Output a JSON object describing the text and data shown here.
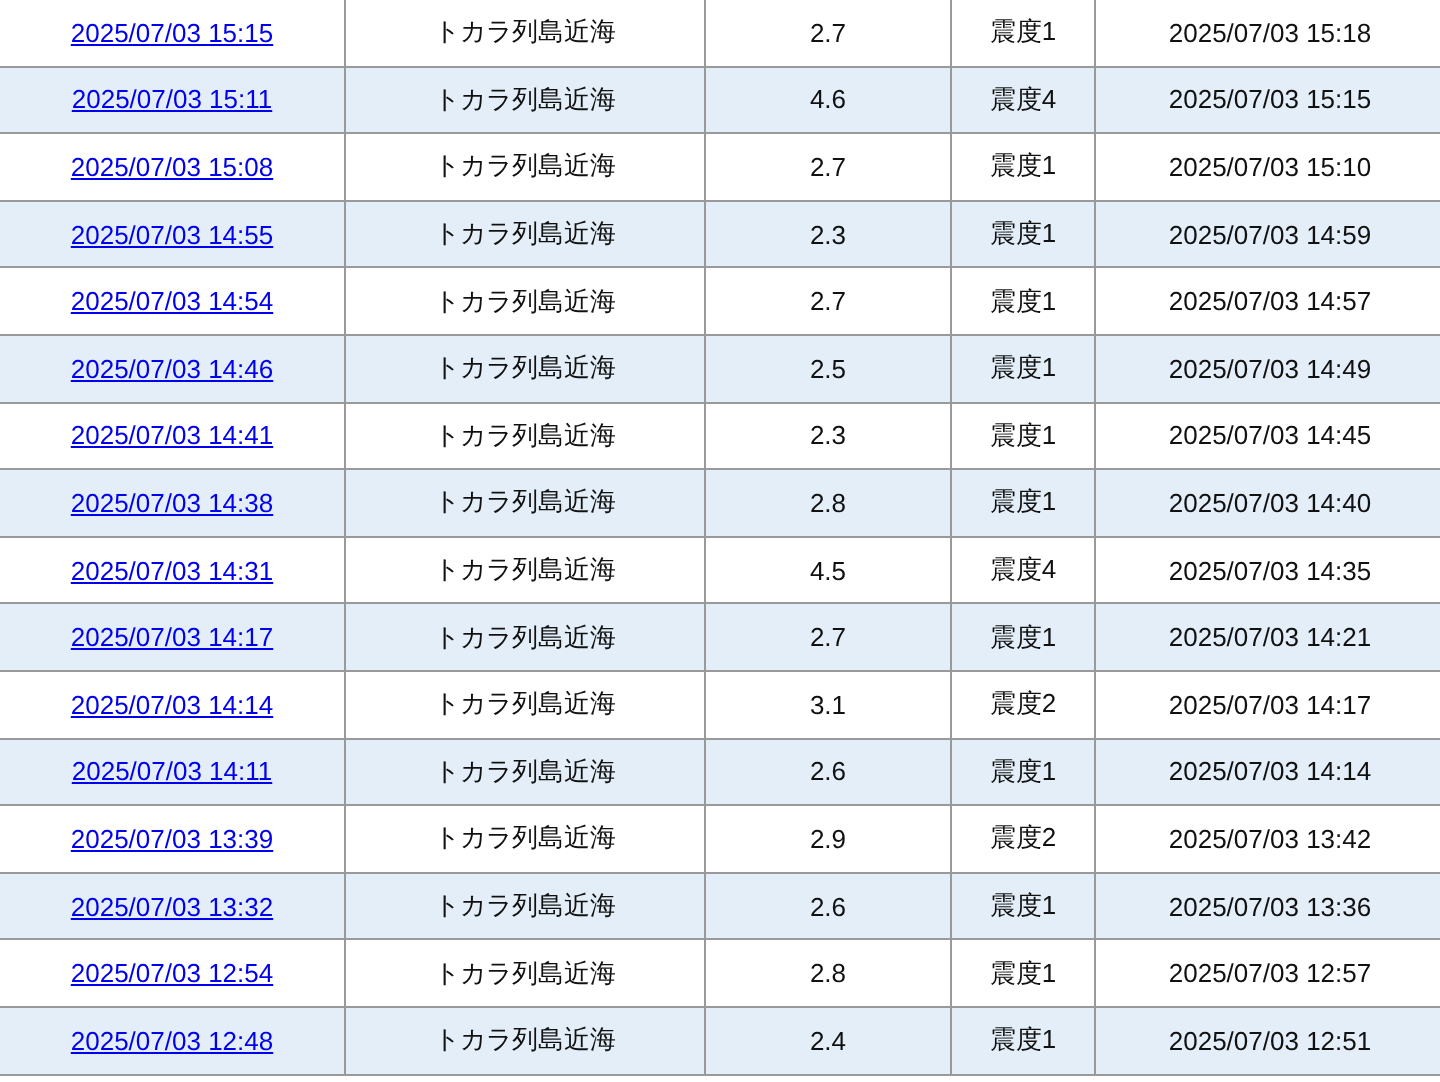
{
  "table": {
    "rows": [
      {
        "time": "2025/07/03 15:15",
        "epicenter": "トカラ列島近海",
        "magnitude": "2.7",
        "intensity": "震度1",
        "announced": "2025/07/03 15:18"
      },
      {
        "time": "2025/07/03 15:11",
        "epicenter": "トカラ列島近海",
        "magnitude": "4.6",
        "intensity": "震度4",
        "announced": "2025/07/03 15:15"
      },
      {
        "time": "2025/07/03 15:08",
        "epicenter": "トカラ列島近海",
        "magnitude": "2.7",
        "intensity": "震度1",
        "announced": "2025/07/03 15:10"
      },
      {
        "time": "2025/07/03 14:55",
        "epicenter": "トカラ列島近海",
        "magnitude": "2.3",
        "intensity": "震度1",
        "announced": "2025/07/03 14:59"
      },
      {
        "time": "2025/07/03 14:54",
        "epicenter": "トカラ列島近海",
        "magnitude": "2.7",
        "intensity": "震度1",
        "announced": "2025/07/03 14:57"
      },
      {
        "time": "2025/07/03 14:46",
        "epicenter": "トカラ列島近海",
        "magnitude": "2.5",
        "intensity": "震度1",
        "announced": "2025/07/03 14:49"
      },
      {
        "time": "2025/07/03 14:41",
        "epicenter": "トカラ列島近海",
        "magnitude": "2.3",
        "intensity": "震度1",
        "announced": "2025/07/03 14:45"
      },
      {
        "time": "2025/07/03 14:38",
        "epicenter": "トカラ列島近海",
        "magnitude": "2.8",
        "intensity": "震度1",
        "announced": "2025/07/03 14:40"
      },
      {
        "time": "2025/07/03 14:31",
        "epicenter": "トカラ列島近海",
        "magnitude": "4.5",
        "intensity": "震度4",
        "announced": "2025/07/03 14:35"
      },
      {
        "time": "2025/07/03 14:17",
        "epicenter": "トカラ列島近海",
        "magnitude": "2.7",
        "intensity": "震度1",
        "announced": "2025/07/03 14:21"
      },
      {
        "time": "2025/07/03 14:14",
        "epicenter": "トカラ列島近海",
        "magnitude": "3.1",
        "intensity": "震度2",
        "announced": "2025/07/03 14:17"
      },
      {
        "time": "2025/07/03 14:11",
        "epicenter": "トカラ列島近海",
        "magnitude": "2.6",
        "intensity": "震度1",
        "announced": "2025/07/03 14:14"
      },
      {
        "time": "2025/07/03 13:39",
        "epicenter": "トカラ列島近海",
        "magnitude": "2.9",
        "intensity": "震度2",
        "announced": "2025/07/03 13:42"
      },
      {
        "time": "2025/07/03 13:32",
        "epicenter": "トカラ列島近海",
        "magnitude": "2.6",
        "intensity": "震度1",
        "announced": "2025/07/03 13:36"
      },
      {
        "time": "2025/07/03 12:54",
        "epicenter": "トカラ列島近海",
        "magnitude": "2.8",
        "intensity": "震度1",
        "announced": "2025/07/03 12:57"
      },
      {
        "time": "2025/07/03 12:48",
        "epicenter": "トカラ列島近海",
        "magnitude": "2.4",
        "intensity": "震度1",
        "announced": "2025/07/03 12:51"
      }
    ]
  }
}
